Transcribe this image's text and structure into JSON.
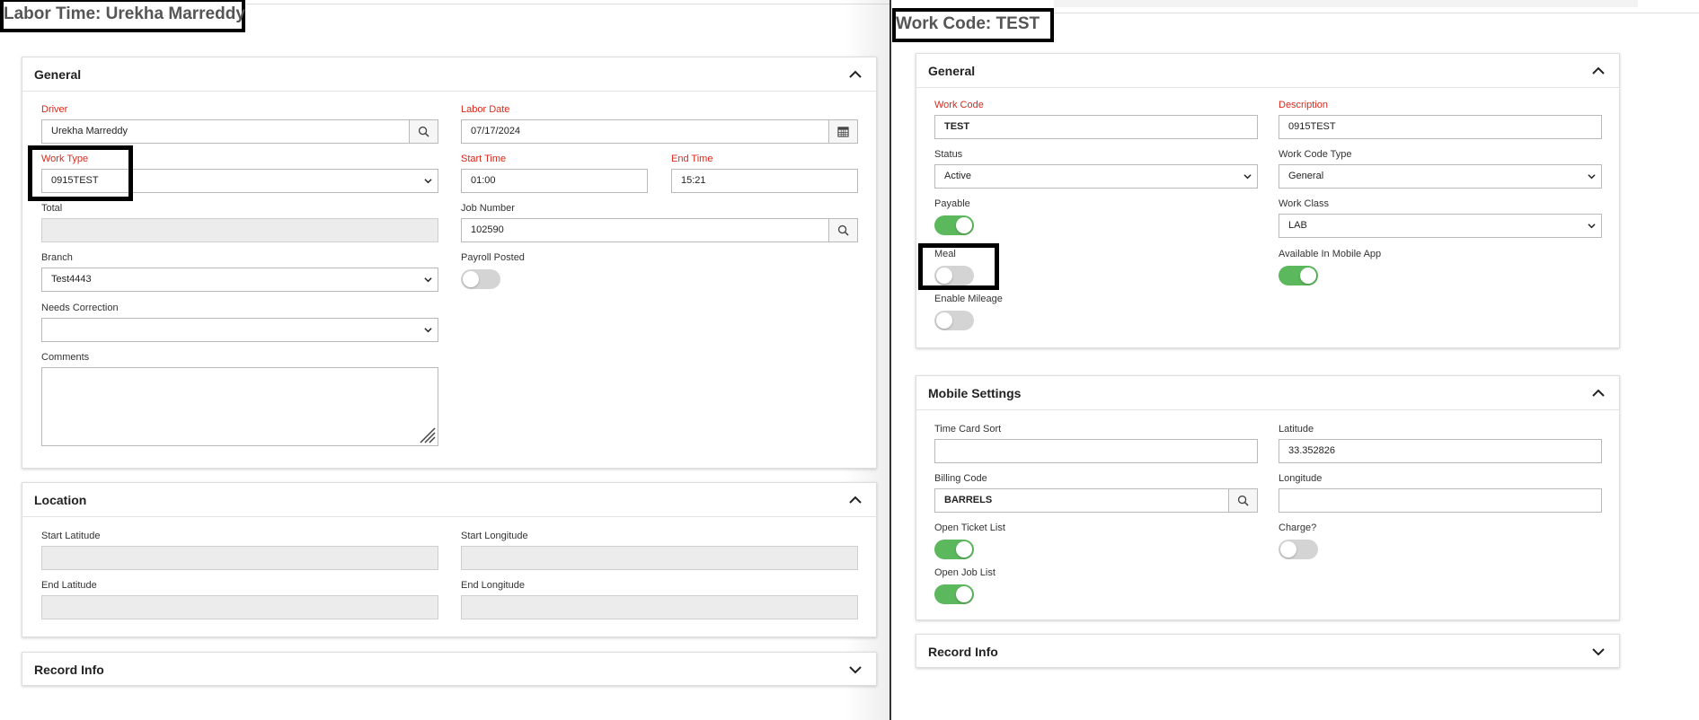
{
  "labor": {
    "title": "Labor Time: Urekha Marreddy",
    "general": {
      "header": "General",
      "driver_label": "Driver",
      "driver_value": "Urekha Marreddy",
      "labor_date_label": "Labor Date",
      "labor_date_value": "07/17/2024",
      "work_type_label": "Work Type",
      "work_type_value": "0915TEST",
      "start_time_label": "Start Time",
      "start_time_value": "01:00",
      "end_time_label": "End Time",
      "end_time_value": "15:21",
      "total_label": "Total",
      "total_value": "",
      "job_number_label": "Job Number",
      "job_number_value": "102590",
      "branch_label": "Branch",
      "branch_value": "Test4443",
      "payroll_posted_label": "Payroll Posted",
      "payroll_posted": false,
      "needs_correction_label": "Needs Correction",
      "needs_correction_value": "",
      "comments_label": "Comments",
      "comments_value": ""
    },
    "location": {
      "header": "Location",
      "start_lat_label": "Start Latitude",
      "start_lon_label": "Start Longitude",
      "end_lat_label": "End Latitude",
      "end_lon_label": "End Longitude"
    },
    "record_info": {
      "header": "Record Info"
    }
  },
  "workcode": {
    "title": "Work Code: TEST",
    "general": {
      "header": "General",
      "work_code_label": "Work Code",
      "work_code_value": "TEST",
      "description_label": "Description",
      "description_value": "0915TEST",
      "status_label": "Status",
      "status_value": "Active",
      "work_code_type_label": "Work Code Type",
      "work_code_type_value": "General",
      "payable_label": "Payable",
      "payable": true,
      "work_class_label": "Work Class",
      "work_class_value": "LAB",
      "meal_label": "Meal",
      "meal": false,
      "available_mobile_label": "Available In Mobile App",
      "available_mobile": true,
      "enable_mileage_label": "Enable Mileage",
      "enable_mileage": false
    },
    "mobile": {
      "header": "Mobile Settings",
      "time_card_sort_label": "Time Card Sort",
      "time_card_sort_value": "",
      "latitude_label": "Latitude",
      "latitude_value": "33.352826",
      "billing_code_label": "Billing Code",
      "billing_code_value": "BARRELS",
      "longitude_label": "Longitude",
      "longitude_value": "",
      "open_ticket_label": "Open Ticket List",
      "open_ticket": true,
      "charge_label": "Charge?",
      "charge": false,
      "open_job_label": "Open Job List",
      "open_job": true
    },
    "record_info": {
      "header": "Record Info"
    }
  },
  "colors": {
    "required_label": "#d9291c",
    "toggle_on": "#5cb85c",
    "toggle_off": "#d4d4d4"
  }
}
